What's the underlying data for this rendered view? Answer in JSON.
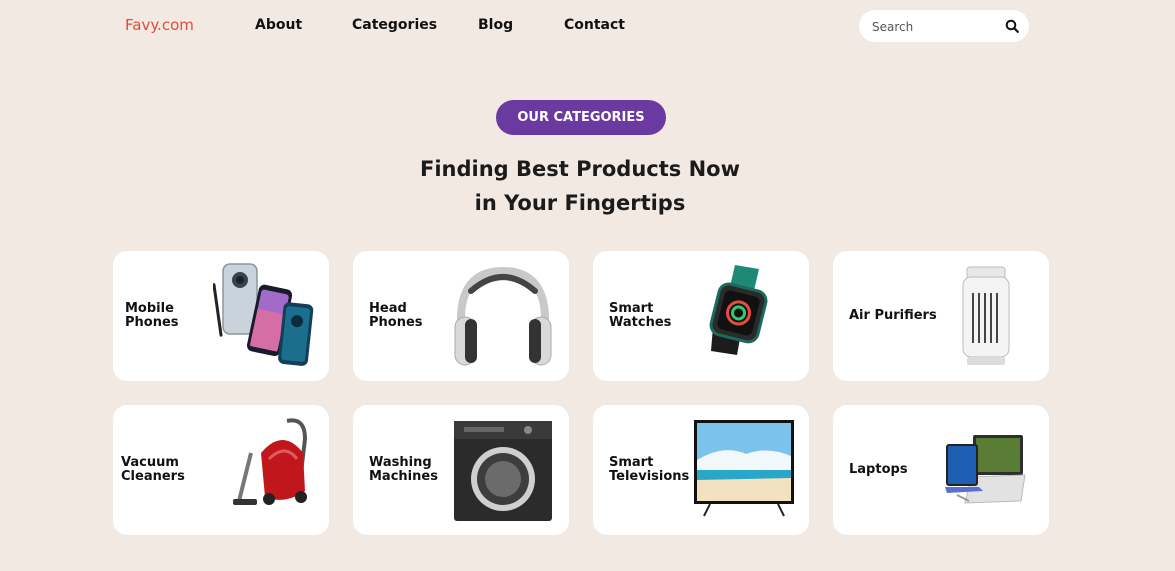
{
  "header": {
    "brand": "Favy.com",
    "nav": [
      "About",
      "Categories",
      "Blog",
      "Contact"
    ],
    "search_placeholder": "Search"
  },
  "hero": {
    "badge": "OUR CATEGORIES",
    "title_line1": "Finding Best Products Now",
    "title_line2": "in Your Fingertips"
  },
  "categories": [
    {
      "line1": "Mobile",
      "line2": "Phones",
      "icon": "mobile-phones-image"
    },
    {
      "line1": "Head",
      "line2": "Phones",
      "icon": "headphones-image"
    },
    {
      "line1": "Smart",
      "line2": "Watches",
      "icon": "smart-watch-image"
    },
    {
      "line1": "Air Purifiers",
      "line2": "",
      "icon": "air-purifier-image"
    },
    {
      "line1": "Vacuum",
      "line2": "Cleaners",
      "icon": "vacuum-cleaner-image"
    },
    {
      "line1": "Washing",
      "line2": "Machines",
      "icon": "washing-machine-image"
    },
    {
      "line1": "Smart",
      "line2": "Televisions",
      "icon": "television-image"
    },
    {
      "line1": "Laptops",
      "line2": "",
      "icon": "laptops-image"
    }
  ],
  "colors": {
    "background": "#f3e9e3",
    "brand": "#e24b3b",
    "accent": "#6a3aa0",
    "card": "#ffffff"
  }
}
